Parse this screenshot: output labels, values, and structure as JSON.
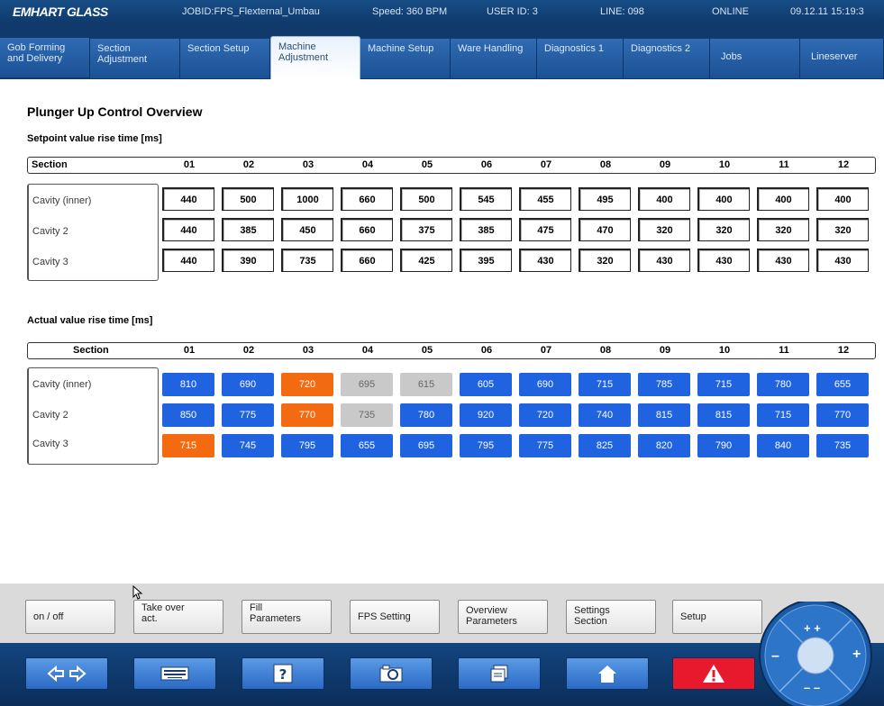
{
  "header": {
    "logo": "EMHART GLASS",
    "jobid": "JOBID:FPS_Flexternal_Umbau",
    "speed": "Speed: 360 BPM",
    "user": "USER ID: 3",
    "line": "LINE: 098",
    "status": "ONLINE",
    "datetime": "09.12.11 15:19:3"
  },
  "tabs": [
    {
      "label": "Gob Forming and Delivery"
    },
    {
      "label": "Section Adjustment"
    },
    {
      "label": "Section Setup"
    },
    {
      "label": "Machine Adjustment"
    },
    {
      "label": "Machine Setup"
    },
    {
      "label": "Ware Handling"
    },
    {
      "label": "Diagnostics 1"
    },
    {
      "label": "Diagnostics 2"
    },
    {
      "label": "Jobs"
    },
    {
      "label": "Lineserver"
    }
  ],
  "page": {
    "title": "Plunger Up Control Overview",
    "setpoint_title": "Setpoint value rise time [ms]",
    "actual_title": "Actual value rise time [ms]",
    "section_label": "Section",
    "sections": [
      "01",
      "02",
      "03",
      "04",
      "05",
      "06",
      "07",
      "08",
      "09",
      "10",
      "11",
      "12"
    ],
    "rows": [
      "Cavity (inner)",
      "Cavity 2",
      "Cavity 3"
    ]
  },
  "setpoint": [
    [
      "440",
      "500",
      "1000",
      "660",
      "500",
      "545",
      "455",
      "495",
      "400",
      "400",
      "400",
      "400"
    ],
    [
      "440",
      "385",
      "450",
      "660",
      "375",
      "385",
      "475",
      "470",
      "320",
      "320",
      "320",
      "320"
    ],
    [
      "440",
      "390",
      "735",
      "660",
      "425",
      "395",
      "430",
      "320",
      "430",
      "430",
      "430",
      "430"
    ]
  ],
  "actual": [
    [
      {
        "v": "810",
        "s": "blue"
      },
      {
        "v": "690",
        "s": "blue"
      },
      {
        "v": "720",
        "s": "orange"
      },
      {
        "v": "695",
        "s": "grey"
      },
      {
        "v": "615",
        "s": "grey"
      },
      {
        "v": "605",
        "s": "blue"
      },
      {
        "v": "690",
        "s": "blue"
      },
      {
        "v": "715",
        "s": "blue"
      },
      {
        "v": "785",
        "s": "blue"
      },
      {
        "v": "715",
        "s": "blue"
      },
      {
        "v": "780",
        "s": "blue"
      },
      {
        "v": "655",
        "s": "blue"
      }
    ],
    [
      {
        "v": "850",
        "s": "blue"
      },
      {
        "v": "775",
        "s": "blue"
      },
      {
        "v": "770",
        "s": "orange"
      },
      {
        "v": "735",
        "s": "grey"
      },
      {
        "v": "780",
        "s": "blue"
      },
      {
        "v": "920",
        "s": "blue"
      },
      {
        "v": "720",
        "s": "blue"
      },
      {
        "v": "740",
        "s": "blue"
      },
      {
        "v": "815",
        "s": "blue"
      },
      {
        "v": "815",
        "s": "blue"
      },
      {
        "v": "715",
        "s": "blue"
      },
      {
        "v": "770",
        "s": "blue"
      }
    ],
    [
      {
        "v": "715",
        "s": "orange"
      },
      {
        "v": "745",
        "s": "blue"
      },
      {
        "v": "795",
        "s": "blue"
      },
      {
        "v": "655",
        "s": "blue"
      },
      {
        "v": "695",
        "s": "blue"
      },
      {
        "v": "795",
        "s": "blue"
      },
      {
        "v": "775",
        "s": "blue"
      },
      {
        "v": "825",
        "s": "blue"
      },
      {
        "v": "820",
        "s": "blue"
      },
      {
        "v": "790",
        "s": "blue"
      },
      {
        "v": "840",
        "s": "blue"
      },
      {
        "v": "735",
        "s": "blue"
      }
    ]
  ],
  "colors": {
    "blue": "#1f63e0",
    "orange": "#f36a10",
    "grey": "#c9c9c9",
    "warning_red": "#e8192c"
  },
  "function_buttons": [
    {
      "label": "on / off"
    },
    {
      "label": "Take over act."
    },
    {
      "label": "Fill Parameters"
    },
    {
      "label": "FPS Setting"
    },
    {
      "label": "Overview Parameters"
    },
    {
      "label": "Settings Section"
    },
    {
      "label": "Setup"
    }
  ],
  "nav_buttons": [
    {
      "icon": "arrows-left-right-icon"
    },
    {
      "icon": "keyboard-icon"
    },
    {
      "icon": "help-icon"
    },
    {
      "icon": "camera-icon"
    },
    {
      "icon": "windows-icon"
    },
    {
      "icon": "home-icon"
    },
    {
      "icon": "warning-icon"
    }
  ],
  "wheel": {
    "up": "+ +",
    "down": "– –",
    "left": "–",
    "right": "+"
  }
}
